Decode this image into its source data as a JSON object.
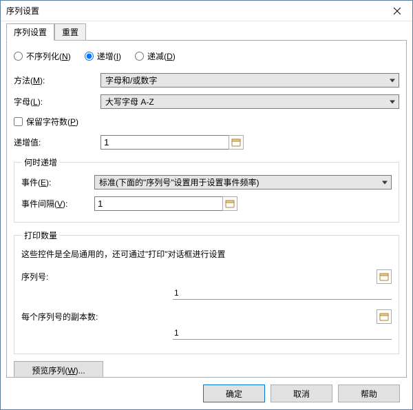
{
  "window": {
    "title": "序列设置"
  },
  "tabs": {
    "t0": "序列设置",
    "t1": "重置"
  },
  "radios": {
    "none": "不序列化",
    "none_acc": "N",
    "inc": "递增",
    "inc_acc": "I",
    "dec": "递减",
    "dec_acc": "D"
  },
  "labels": {
    "method": "方法",
    "method_acc": "M",
    "alphabet": "字母",
    "alphabet_acc": "L",
    "preserve": "保留字符数",
    "preserve_acc": "P",
    "increment": "递增值:",
    "when_legend": "何时递增",
    "event": "事件",
    "event_acc": "E",
    "event_interval": "事件间隔",
    "event_interval_acc": "V",
    "print_legend": "打印数量",
    "print_desc": "这些控件是全局通用的，还可通过\"打印\"对话框进行设置",
    "serial_number": "序列号:",
    "copies": "每个序列号的副本数:",
    "preview": "预览序列",
    "preview_acc": "W"
  },
  "values": {
    "method": "字母和/或数字",
    "alphabet": "大写字母 A-Z",
    "increment": "1",
    "event": "标准(下面的\"序列号\"设置用于设置事件频率)",
    "event_interval": "1",
    "serial_number": "1",
    "copies": "1"
  },
  "buttons": {
    "ok": "确定",
    "cancel": "取消",
    "help": "帮助"
  }
}
